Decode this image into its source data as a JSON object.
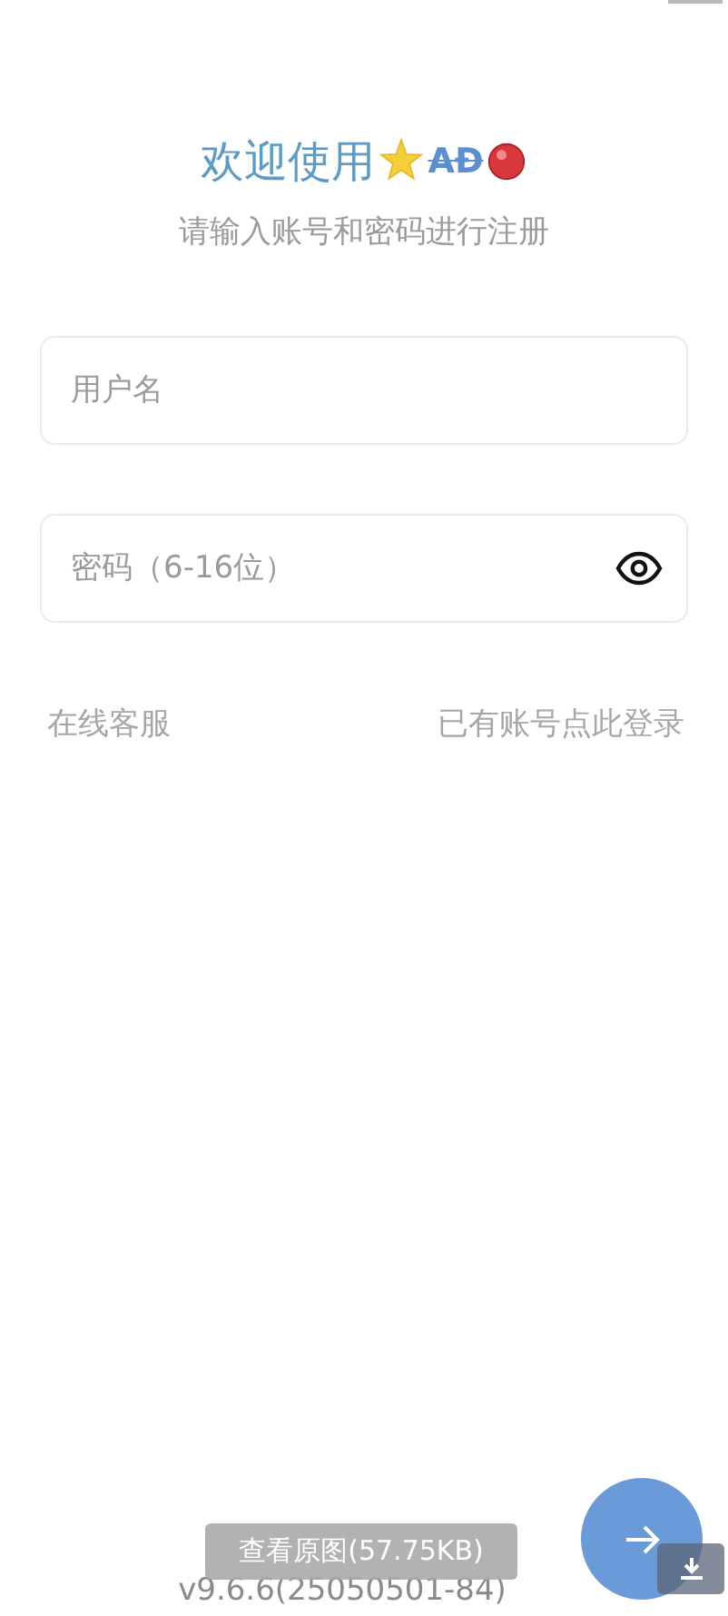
{
  "header": {
    "title": "欢迎使用",
    "brand": "AĐ",
    "subtitle": "请输入账号和密码进行注册"
  },
  "fields": [
    {
      "kind": "text",
      "placeholder": "用户名"
    },
    {
      "kind": "password",
      "placeholder": "密码（6-16位）"
    }
  ],
  "links": {
    "support": "在线客服",
    "login": "已有账号点此登录"
  },
  "version": "v9.6.6(25050501-84)",
  "overlay": {
    "view_original": "查看原图(57.75KB)"
  }
}
